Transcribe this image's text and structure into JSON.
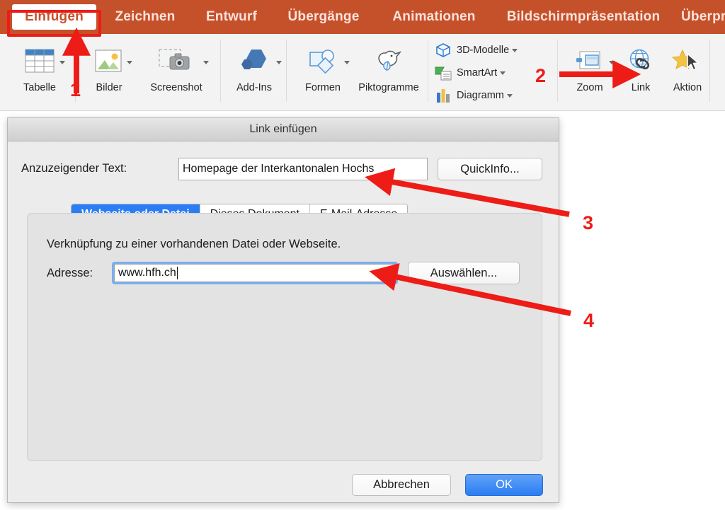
{
  "ribbon": {
    "accent_color": "#c5512b",
    "annotation_color": "#ee1c16",
    "tabs": [
      {
        "label": "Einfügen",
        "active": true
      },
      {
        "label": "Zeichnen",
        "active": false
      },
      {
        "label": "Entwurf",
        "active": false
      },
      {
        "label": "Übergänge",
        "active": false
      },
      {
        "label": "Animationen",
        "active": false
      },
      {
        "label": "Bildschirmpräsentation",
        "active": false
      },
      {
        "label": "Überprüfen",
        "active": false
      }
    ],
    "groups": {
      "tables": [
        {
          "label": "Tabelle",
          "icon": "table-icon",
          "has_caret": true
        }
      ],
      "images": [
        {
          "label": "Bilder",
          "icon": "pictures-icon",
          "has_caret": true
        },
        {
          "label": "Screenshot",
          "icon": "screenshot-icon",
          "has_caret": true
        }
      ],
      "addins": [
        {
          "label": "Add-Ins",
          "icon": "addins-icon",
          "has_caret": true
        }
      ],
      "illustrations": [
        {
          "label": "Formen",
          "icon": "shapes-icon",
          "has_caret": true
        },
        {
          "label": "Piktogramme",
          "icon": "icons-pictogram-icon",
          "has_caret": false
        }
      ],
      "gallery": [
        {
          "label": "3D-Modelle",
          "icon": "3d-model-icon",
          "has_caret": true
        },
        {
          "label": "SmartArt",
          "icon": "smartart-icon",
          "has_caret": true
        },
        {
          "label": "Diagramm",
          "icon": "chart-icon",
          "has_caret": true
        }
      ],
      "links": [
        {
          "label": "Zoom",
          "icon": "zoom-icon",
          "has_caret": true
        },
        {
          "label": "Link",
          "icon": "link-icon",
          "has_caret": false
        },
        {
          "label": "Aktion",
          "icon": "action-icon",
          "has_caret": false
        }
      ]
    }
  },
  "dialog": {
    "title": "Link einfügen",
    "display_text": {
      "label": "Anzuzeigender Text:",
      "value": "Homepage der Interkantonalen Hochs"
    },
    "quickinfo_button": "QuickInfo...",
    "tabs": [
      {
        "label": "Webseite oder Datei",
        "active": true
      },
      {
        "label": "Dieses Dokument",
        "active": false
      },
      {
        "label": "E-Mail-Adresse",
        "active": false
      }
    ],
    "panel": {
      "description": "Verknüpfung zu einer vorhandenen Datei oder Webseite.",
      "address_label": "Adresse:",
      "address_value": "www.hfh.ch",
      "browse_button": "Auswählen..."
    },
    "cancel_button": "Abbrechen",
    "ok_button": "OK"
  },
  "annotations": {
    "markers": [
      {
        "number": "1",
        "points_to": "einfuegen-tab"
      },
      {
        "number": "2",
        "points_to": "link-button"
      },
      {
        "number": "3",
        "points_to": "display-text-input"
      },
      {
        "number": "4",
        "points_to": "address-field"
      }
    ]
  }
}
